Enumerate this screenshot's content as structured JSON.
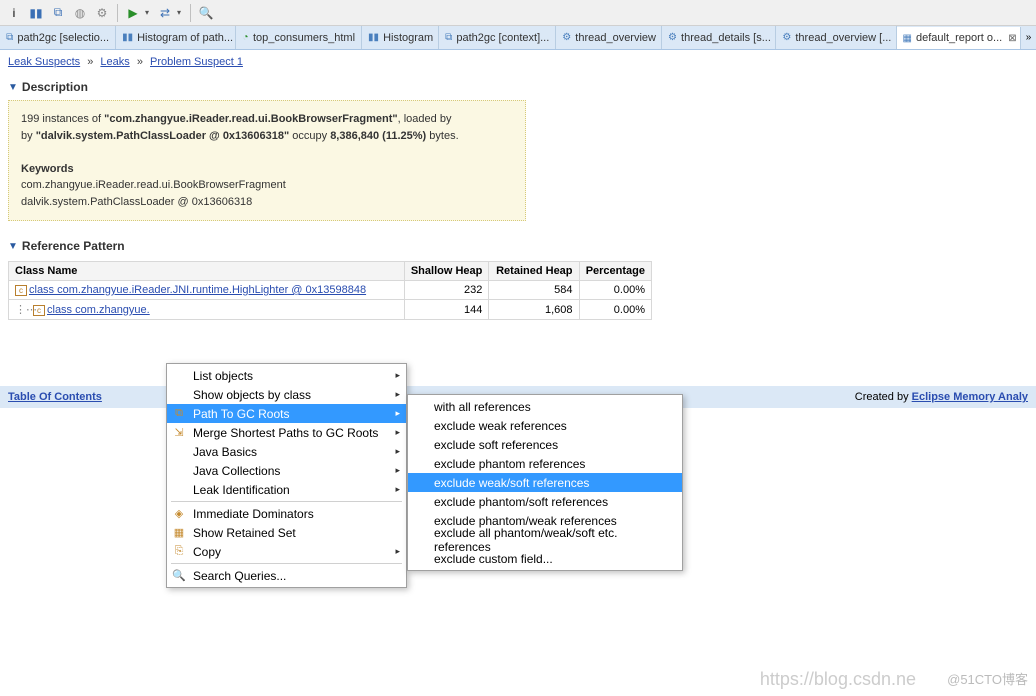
{
  "toolbar_icons": [
    "i",
    "hist",
    "tree",
    "db",
    "gear",
    "play",
    "arrow",
    "search"
  ],
  "tabs": [
    {
      "label": "path2gc [selectio...",
      "icon": "tree"
    },
    {
      "label": "Histogram of path...",
      "icon": "hist"
    },
    {
      "label": "top_consumers_html",
      "icon": "pie"
    },
    {
      "label": "Histogram",
      "icon": "hist"
    },
    {
      "label": "path2gc [context]...",
      "icon": "tree"
    },
    {
      "label": "thread_overview",
      "icon": "gear"
    },
    {
      "label": "thread_details [s...",
      "icon": "gear"
    },
    {
      "label": "thread_overview [...",
      "icon": "gear"
    },
    {
      "label": "default_report  o...",
      "icon": "report",
      "active": true,
      "close": true
    }
  ],
  "breadcrumb": {
    "items": [
      "Leak Suspects",
      "Leaks",
      "Problem Suspect 1"
    ]
  },
  "sections": {
    "description_title": "Description",
    "reference_title": "Reference Pattern"
  },
  "desc": {
    "line1_a": "199 instances of ",
    "line1_b": "\"com.zhangyue.iReader.read.ui.BookBrowserFragment\"",
    "line1_c": ", loaded by ",
    "line2_a": "\"dalvik.system.PathClassLoader @ 0x13606318\"",
    "line2_b": " occupy ",
    "line2_c": "8,386,840 (11.25%)",
    "line2_d": " bytes.",
    "kw_title": "Keywords",
    "kw1": "com.zhangyue.iReader.read.ui.BookBrowserFragment",
    "kw2": "dalvik.system.PathClassLoader @ 0x13606318"
  },
  "ref_table": {
    "headers": [
      "Class Name",
      "Shallow Heap",
      "Retained Heap",
      "Percentage"
    ],
    "rows": [
      {
        "name": "class com.zhangyue.iReader.JNI.runtime.HighLighter @ 0x13598848",
        "shallow": "232",
        "retained": "584",
        "pct": "0.00%",
        "indent": 0
      },
      {
        "name": "class com.zhangyue.",
        "shallow": "144",
        "retained": "1,608",
        "pct": "0.00%",
        "indent": 1
      }
    ]
  },
  "footer": {
    "toc": "Table Of Contents",
    "created_by": "Created by ",
    "link": "Eclipse Memory Analy"
  },
  "context": [
    {
      "label": "List objects",
      "arrow": true
    },
    {
      "label": "Show objects by class",
      "arrow": true
    },
    {
      "label": "Path To GC Roots",
      "arrow": true,
      "hover": true,
      "icon": "tree"
    },
    {
      "label": "Merge Shortest Paths to GC Roots",
      "arrow": true,
      "icon": "merge"
    },
    {
      "label": "Java Basics",
      "arrow": true
    },
    {
      "label": "Java Collections",
      "arrow": true
    },
    {
      "label": "Leak Identification",
      "arrow": true
    },
    {
      "sep": true
    },
    {
      "label": "Immediate Dominators",
      "icon": "dom"
    },
    {
      "label": "Show Retained Set",
      "icon": "ret"
    },
    {
      "label": "Copy",
      "arrow": true,
      "icon": "copy"
    },
    {
      "sep": true
    },
    {
      "label": "Search Queries...",
      "icon": "search"
    }
  ],
  "submenu": [
    {
      "label": "with all references"
    },
    {
      "label": "exclude weak references"
    },
    {
      "label": "exclude soft references"
    },
    {
      "label": "exclude phantom references"
    },
    {
      "label": "exclude weak/soft references",
      "hover": true
    },
    {
      "label": "exclude phantom/soft references"
    },
    {
      "label": "exclude phantom/weak references"
    },
    {
      "label": "exclude all phantom/weak/soft etc. references"
    },
    {
      "label": "exclude custom field..."
    }
  ],
  "watermark": "https://blog.csdn.ne",
  "watermark2": "@51CTO博客"
}
